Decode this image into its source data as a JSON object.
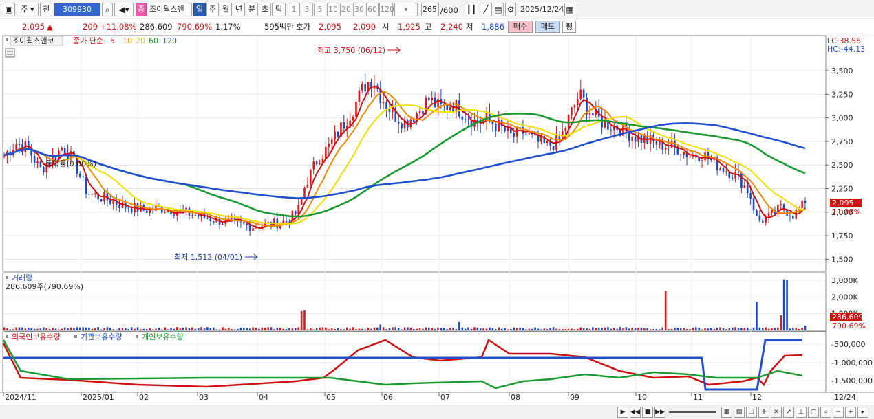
{
  "toolbar": {
    "market": "주",
    "prev_label": "전",
    "stock_code": "309930",
    "stock_badge": "증",
    "stock_name": "조이웍스앤",
    "periods": [
      "일",
      "주",
      "월",
      "년",
      "분",
      "초",
      "틱"
    ],
    "selected_period": "일",
    "intervals": [
      "1",
      "3",
      "5",
      "10",
      "20",
      "30",
      "60",
      "120"
    ],
    "count": "265",
    "count_max": "/600",
    "date": "2025/12/24"
  },
  "quote": {
    "price": "2,095",
    "arrow": "▲",
    "change": "209",
    "change_pct": "+11.08%",
    "volume": "286,609",
    "volume_pct": "790.69%",
    "turnover": "1.17%",
    "amount": "595백만",
    "ask_label": "호가",
    "ask": "2,095",
    "bid": "2,090",
    "open_label": "시",
    "open": "1,925",
    "high_label": "고",
    "high": "2,240",
    "low_label": "저",
    "low": "1,886",
    "buy": "매수",
    "sell": "매도",
    "eval": "평"
  },
  "price_panel": {
    "legend_name": "조이웍스앤코",
    "legend_ma": "종가 단순",
    "ma_periods": [
      "5",
      "10",
      "20",
      "60",
      "120"
    ],
    "ma_colors": [
      "#d01010",
      "#f08a00",
      "#f0e000",
      "#1a9a30",
      "#2050d0"
    ],
    "lc": "LC:38.56",
    "hc": "HC:-44.13",
    "high_marker": "최고 3,750 (06/12)",
    "low_marker": "최저 1,512 (04/01)",
    "ratio_label": "등락률(0.00%)",
    "current_price": "2,095",
    "current_pct": "11.08%",
    "y_ticks": [
      "3,500",
      "3,250",
      "3,000",
      "2,750",
      "2,500",
      "2,250",
      "2,000",
      "1,750",
      "1,500"
    ]
  },
  "volume_panel": {
    "title": "거래량",
    "value": "286,609주(790.69%)",
    "y_ticks": [
      "3,000K",
      "2,000K",
      "1,000K"
    ],
    "current": "286,609",
    "current_pct": "790.69%"
  },
  "holding_panel": {
    "series": [
      "외국인보유수량",
      "기관보유수량",
      "개인보유수량"
    ],
    "series_colors": [
      "#d01010",
      "#2050d0",
      "#1a9a30"
    ],
    "y_ticks": [
      "-500,000",
      "-1,000,000",
      "-1,500,000"
    ]
  },
  "x_axis": [
    "2024/11",
    "2025/01",
    "02",
    "03",
    "04",
    "05",
    "06",
    "07",
    "08",
    "09",
    "10",
    "11",
    "12",
    "12/24"
  ],
  "chart_data": {
    "type": "line",
    "title": "",
    "x": [
      "2024-11",
      "2025-01",
      "2025-02",
      "2025-03",
      "2025-04",
      "2025-05",
      "2025-06",
      "2025-07",
      "2025-08",
      "2025-09",
      "2025-10",
      "2025-11",
      "2025-12",
      "2025-12-24"
    ],
    "series": [
      {
        "name": "종가",
        "values": [
          2650,
          2250,
          2030,
          2000,
          1850,
          1880,
          3350,
          3050,
          2950,
          2850,
          2900,
          2650,
          2400,
          2095
        ]
      },
      {
        "name": "120",
        "values": [
          2270,
          2270,
          2280,
          2260,
          2230,
          2220,
          2250,
          2400,
          2600,
          2750,
          2880,
          2910,
          2880,
          2730
        ]
      },
      {
        "name": "60",
        "values": [
          2230,
          2260,
          2270,
          2200,
          2120,
          2000,
          2150,
          2680,
          2990,
          3020,
          2900,
          2800,
          2700,
          2480
        ]
      }
    ],
    "ylim": [
      1400,
      3800
    ],
    "volume": {
      "ylim": [
        0,
        3200
      ],
      "unit": "K"
    }
  }
}
